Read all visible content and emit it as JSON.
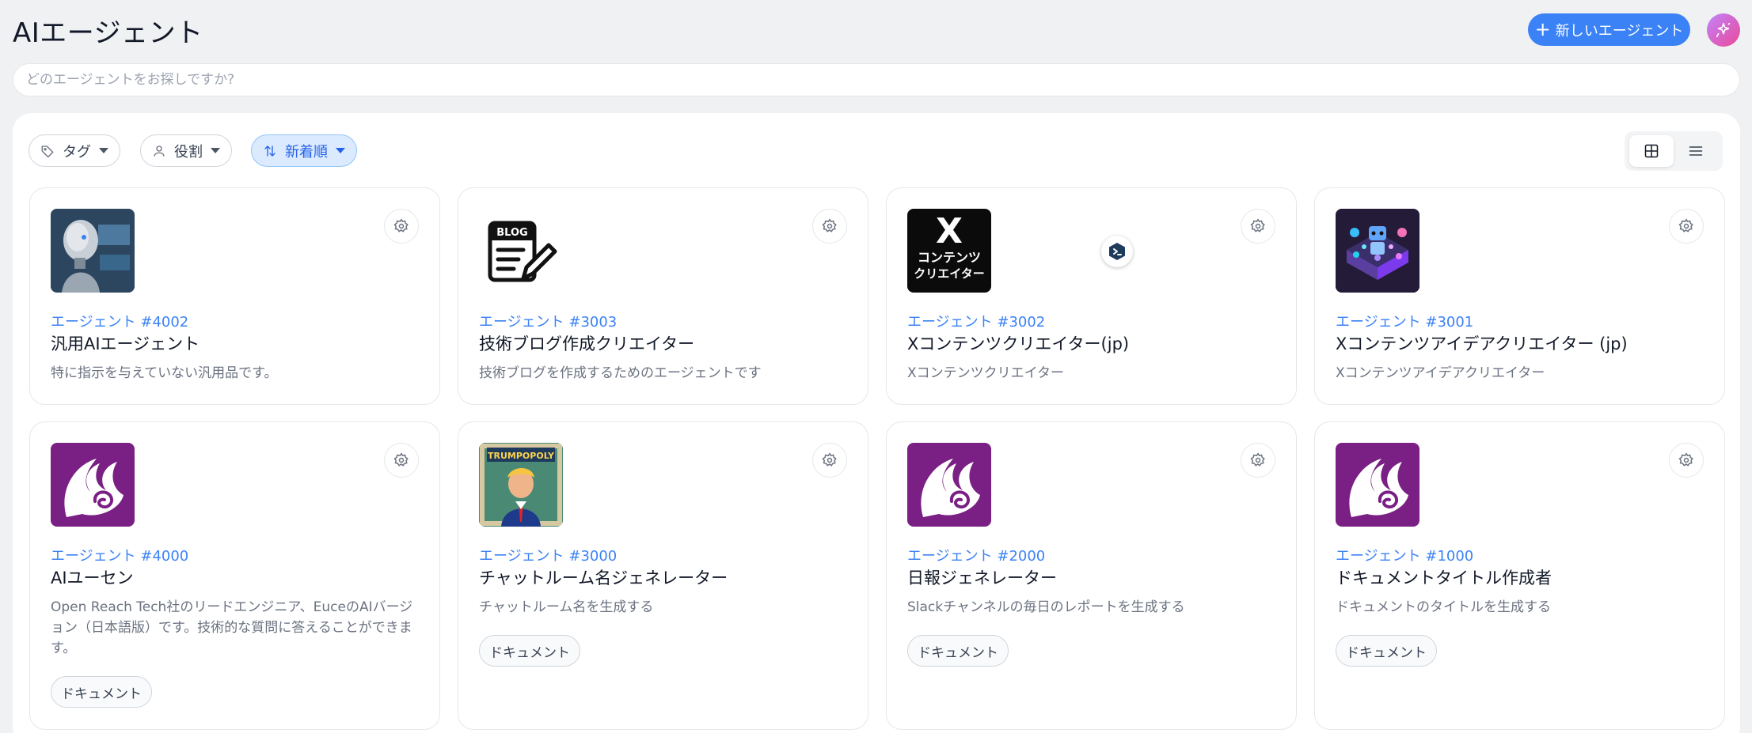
{
  "header": {
    "title": "AIエージェント",
    "new_agent_label": "新しいエージェント",
    "ai_button_icon": "sparkle-icon"
  },
  "search": {
    "placeholder": "どのエージェントをお探しですか?",
    "value": ""
  },
  "filters": {
    "tag_label": "タグ",
    "role_label": "役割",
    "sort_label": "新着順"
  },
  "view": {
    "active": "grid",
    "grid_icon": "grid-icon",
    "list_icon": "list-icon"
  },
  "colors": {
    "accent": "#3b82f6",
    "active_filter_bg": "#dbeafe",
    "euce_purple": "#7a2084",
    "page_bg": "#f0f1f3"
  },
  "agents": [
    {
      "id": "エージェント #4002",
      "name": "汎用AIエージェント",
      "description": "特に指示を与えていない汎用品です。",
      "tags": [],
      "thumbnail": "robot-image"
    },
    {
      "id": "エージェント #3003",
      "name": "技術ブログ作成クリエイター",
      "description": "技術ブログを作成するためのエージェントです",
      "tags": [],
      "thumbnail": "blog-icon",
      "thumb_text": "BLOG"
    },
    {
      "id": "エージェント #3002",
      "name": "Xコンテンツクリエイター(jp)",
      "description": "Xコンテンツクリエイター",
      "tags": [],
      "thumbnail": "x-content-creator-logo",
      "thumb_text_1": "X",
      "thumb_text_2": "コンテンツ",
      "thumb_text_3": "クリエイター"
    },
    {
      "id": "エージェント #3001",
      "name": "Xコンテンツアイデアクリエイター (jp)",
      "description": "Xコンテンツアイデアクリエイター",
      "tags": [],
      "thumbnail": "isometric-robot-image"
    },
    {
      "id": "エージェント #4000",
      "name": "AIユーセン",
      "description": "Open Reach Tech社のリードエンジニア、EuceのAIバージョン（日本語版）です。技術的な質問に答えることができます。",
      "tags": [
        "ドキュメント"
      ],
      "thumbnail": "euce-logo"
    },
    {
      "id": "エージェント #3000",
      "name": "チャットルーム名ジェネレーター",
      "description": "チャットルーム名を生成する",
      "tags": [
        "ドキュメント"
      ],
      "thumbnail": "trumpopoly-image",
      "thumb_text": "TRUMPOPOLY"
    },
    {
      "id": "エージェント #2000",
      "name": "日報ジェネレーター",
      "description": "Slackチャンネルの毎日のレポートを生成する",
      "tags": [
        "ドキュメント"
      ],
      "thumbnail": "euce-logo"
    },
    {
      "id": "エージェント #1000",
      "name": "ドキュメントタイトル作成者",
      "description": "ドキュメントのタイトルを生成する",
      "tags": [
        "ドキュメント"
      ],
      "thumbnail": "euce-logo"
    }
  ]
}
